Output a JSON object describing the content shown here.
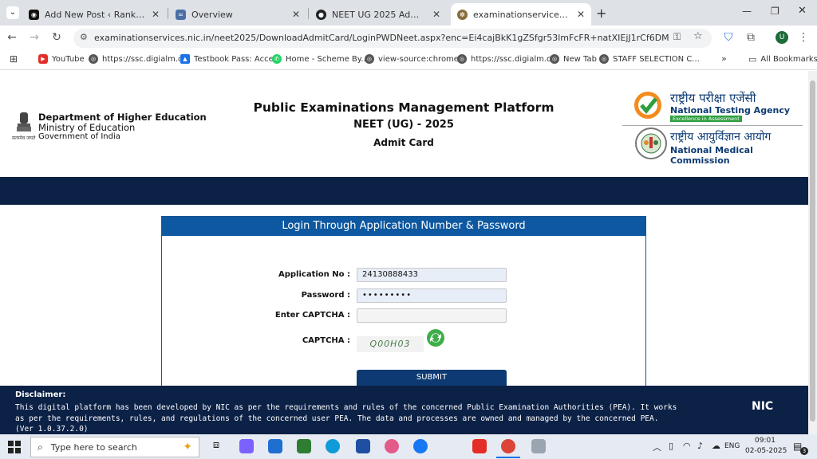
{
  "browser": {
    "tabs": [
      {
        "title": "Add New Post ‹ Rank News — WordPress",
        "active": false
      },
      {
        "title": "Overview",
        "active": false
      },
      {
        "title": "NEET UG 2025 Admit Card",
        "active": false
      },
      {
        "title": "examinationservices.nic.in/neet2025",
        "active": true
      }
    ],
    "url": "examinationservices.nic.in/neet2025/DownloadAdmitCard/LoginPWDNeet.aspx?enc=Ei4cajBkK1gZSfgr53lmFcFR+natXIEjJ1rCf6DMgOr/hcv4rs34T5gNmv...",
    "bookmarks": [
      "YouTube",
      "https://ssc.digialm.c...",
      "Testbook Pass: Acce...",
      "Home - Scheme By...",
      "view-source:chrome...",
      "https://ssc.digialm.c...",
      "New Tab",
      "STAFF SELECTION C..."
    ],
    "all_bookmarks": "All Bookmarks",
    "profile_initial": "U"
  },
  "header": {
    "dept_line1": "Department of Higher Education",
    "dept_line2": "Ministry of Education",
    "dept_line3": "Government of India",
    "emblem_caption": "सत्यमेव जयते",
    "title1": "Public Examinations Management Platform",
    "title2": "NEET (UG) - 2025",
    "title3": "Admit Card",
    "nta_hindi": "राष्ट्रीय परीक्षा एजेंसी",
    "nta_english": "National Testing Agency",
    "nta_tagline": "Excellence in Assessment",
    "nmc_hindi": "राष्ट्रीय आयुर्विज्ञान आयोग",
    "nmc_english": "National Medical Commission"
  },
  "login": {
    "heading": "Login Through Application Number & Password",
    "app_no_label": "Application No :",
    "app_no_value": "24130888433",
    "password_label": "Password :",
    "password_value": "•••••••••",
    "enter_captcha_label": "Enter CAPTCHA :",
    "enter_captcha_value": "",
    "captcha_label": "CAPTCHA :",
    "captcha_text": "Q00H03",
    "submit_label": "SUBMIT"
  },
  "footer": {
    "disclaimer_title": "Disclaimer:",
    "disclaimer_text": "This digital platform has been developed by NIC as per the requirements and rules of the concerned Public Examination Authorities (PEA). It works as per the requirements, rules, and regulations of the concerned user PEA. The data and processes are owned and managed by the concerned PEA. (Ver 1.0.37.2.0)",
    "nic_logo": "NIC"
  },
  "taskbar": {
    "search_placeholder": "Type here to search",
    "language": "ENG",
    "time": "09:01",
    "date": "02-05-2025",
    "notification_count": "3"
  },
  "colors": {
    "navy": "#0c2146",
    "login_header": "#0d58a0",
    "submit": "#0d3a72"
  }
}
